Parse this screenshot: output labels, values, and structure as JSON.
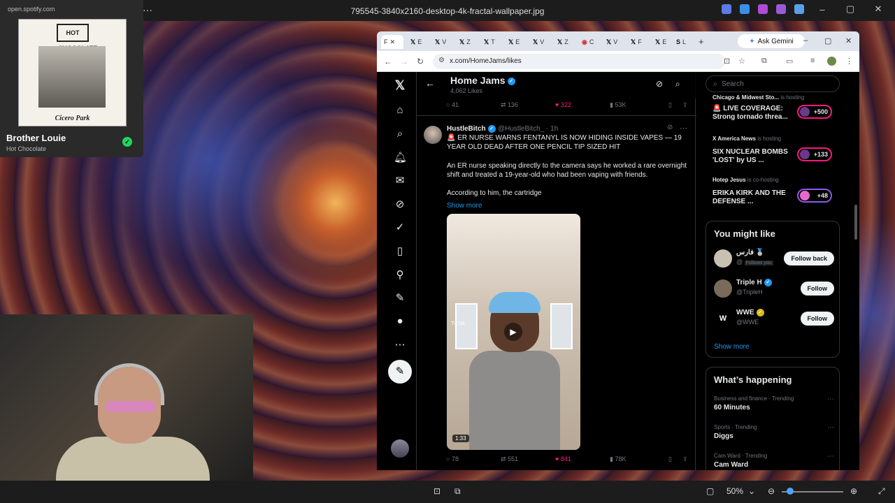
{
  "viewer": {
    "title": "795545-3840x2160-desktop-4k-fractal-wallpaper.jpg",
    "zoom": "50%"
  },
  "spotify": {
    "url": "open.spotify.com",
    "album_caption": "Cicero Park",
    "album_logo": "HOT CHOCOLATE",
    "track": "Brother Louie",
    "artist": "Hot Chocolate"
  },
  "browser": {
    "url": "x.com/HomeJams/likes",
    "gemini": "Ask Gemini",
    "tabs": [
      "F",
      "E",
      "V",
      "Z",
      "T",
      "E",
      "V",
      "Z",
      "C",
      "V",
      "F",
      "E",
      "L"
    ]
  },
  "profile": {
    "name": "Home Jams",
    "likes": "4,062 Likes"
  },
  "prev_post": {
    "replies": "41",
    "reposts": "136",
    "likes": "322",
    "views": "53K"
  },
  "post": {
    "author": "HustleBitch",
    "handle": "@HustleBitch_ · 1h",
    "headline": "🚨 ER NURSE WARNS FENTANYL IS NOW HIDING INSIDE VAPES — 19 YEAR OLD DEAD AFTER ONE PENCIL TIP SIZED HIT",
    "body1": "An ER nurse speaking directly to the camera says he worked a rare overnight shift and treated a 19-year-old who had been vaping with friends.",
    "body2": "According to him, the cartridge",
    "show_more": "Show more",
    "duration": "1:33",
    "tiktok": "TikTok",
    "replies": "78",
    "reposts": "551",
    "likes": "841",
    "views": "78K"
  },
  "search": {
    "placeholder": "Search"
  },
  "live": [
    {
      "host": "Chicago & Midwest Sto...",
      "status": "is hosting",
      "title": "🚨 LIVE COVERAGE: Strong tornado threa...",
      "count": "+500"
    },
    {
      "host": "X America News",
      "status": "is hosting",
      "title": "SIX NUCLEAR BOMBS 'LOST' by US ...",
      "count": "+133"
    },
    {
      "host": "Hotep Jesus",
      "status": "is co-hosting",
      "title": "ERIKA KIRK AND THE DEFENSE ...",
      "count": "+48"
    }
  ],
  "you_might_like": {
    "title": "You might like",
    "people": [
      {
        "name": "فارس 🥈",
        "handle": "@",
        "badge": "Follows you",
        "button": "Follow back"
      },
      {
        "name": "Triple H",
        "handle": "@TripleH",
        "badge": "",
        "button": "Follow"
      },
      {
        "name": "WWE",
        "handle": "@WWE",
        "badge": "",
        "button": "Follow"
      }
    ],
    "show_more": "Show more"
  },
  "whats_happening": {
    "title": "What’s happening",
    "trends": [
      {
        "meta": "Business and finance · Trending",
        "name": "60 Minutes"
      },
      {
        "meta": "Sports · Trending",
        "name": "Diggs"
      },
      {
        "meta": "Cam Ward · Trending",
        "name": "Cam Ward"
      }
    ]
  },
  "colors": {
    "accent": "#1d9bf0",
    "like": "#f91880",
    "spotify_green": "#1ed760"
  }
}
